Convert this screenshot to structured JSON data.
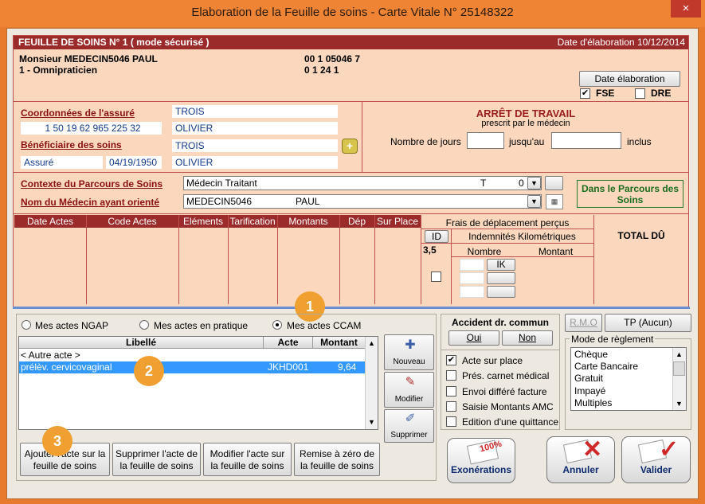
{
  "window": {
    "title": "Elaboration de la Feuille de soins - Carte Vitale N° 25148322",
    "close": "×"
  },
  "header": {
    "title": "FEUILLE DE SOINS  N° 1 ( mode sécurisé )",
    "date": "Date d'élaboration 10/12/2014",
    "doctor_name": "Monsieur MEDECIN5046 PAUL",
    "doctor_specialty": "1 - Omnipraticien",
    "code1": "00 1 05046 7",
    "code2": "0 1 24 1",
    "date_button": "Date élaboration",
    "fse_label": "FSE",
    "dre_label": "DRE"
  },
  "insured": {
    "label": "Coordonnées de l'assuré",
    "number": "1 50 19 62 965 225 32",
    "lastname": "TROIS",
    "firstname": "OLIVIER",
    "beneficiary_label": "Bénéficiaire des soins",
    "beneficiary_lastname": "TROIS",
    "beneficiary_firstname": "OLIVIER",
    "beneficiary_type": "Assuré",
    "birthdate": "04/19/1950"
  },
  "arret": {
    "title": "ARRÊT DE TRAVAIL",
    "subtitle": "prescrit par le médecin",
    "days_label": "Nombre de jours",
    "until_label": "jusqu'au",
    "inclusive_label": "inclus",
    "days_value": "",
    "until_value": ""
  },
  "parcours": {
    "context_label": "Contexte du Parcours de Soins",
    "context_value": "Médecin Traitant",
    "context_code": "T",
    "context_num": "0",
    "doctor_label": "Nom du Médecin ayant orienté",
    "doctor_lastname": "MEDECIN5046",
    "doctor_firstname": "PAUL",
    "badge": "Dans le Parcours des Soins"
  },
  "acts_grid": {
    "columns": [
      "Date Actes",
      "Code Actes",
      "Eléments",
      "Tarification",
      "Montants",
      "Dép",
      "Sur Place"
    ],
    "frais_title": "Frais de déplacement perçus",
    "id_label": "ID",
    "ik_title": "Indemnités Kilométriques",
    "id_value": "3,5",
    "nombre_label": "Nombre",
    "montant_label": "Montant",
    "ik_btn": "IK",
    "total_label": "TOTAL DÛ"
  },
  "acts_filter": {
    "ngap": "Mes actes NGAP",
    "pratique": "Mes actes en pratique",
    "ccam": "Mes actes CCAM",
    "selected": "ccam"
  },
  "acts_list": {
    "columns": [
      "Libellé",
      "Acte",
      "Montant"
    ],
    "rows": [
      {
        "label": "< Autre acte >",
        "code": "",
        "amount": ""
      },
      {
        "label": "prélèv. cervicovaginal",
        "code": "JKHD001",
        "amount": "9,64"
      }
    ]
  },
  "list_side_buttons": {
    "nouveau": "Nouveau",
    "modifier": "Modifier",
    "supprimer": "Supprimer"
  },
  "bottom_buttons": {
    "add_line1": "Ajouter l'acte sur la",
    "add_line2": "feuille de soins",
    "del_line1": "Supprimer l'acte de",
    "del_line2": "la feuille de soins",
    "mod_line1": "Modifier l'acte sur",
    "mod_line2": "la feuille de soins",
    "reset_line1": "Remise à zéro de",
    "reset_line2": "la feuille de soins"
  },
  "accident": {
    "title": "Accident dr. commun",
    "oui": "Oui",
    "non": "Non"
  },
  "options": [
    {
      "label": "Acte sur place",
      "checked": true
    },
    {
      "label": "Prés. carnet médical",
      "checked": false
    },
    {
      "label": "Envoi différé facture",
      "checked": false
    },
    {
      "label": "Saisie Montants AMC",
      "checked": false
    },
    {
      "label": "Edition d'une quittance",
      "checked": false
    }
  ],
  "payment": {
    "rmo": "R.M.O",
    "tp": "TP (Aucun)",
    "title": "Mode de règlement",
    "items": [
      "Chèque",
      "Carte Bancaire",
      "Gratuit",
      "Impayé",
      "Multiples"
    ]
  },
  "actions": {
    "exonerations": "Exonérations",
    "annuler": "Annuler",
    "valider": "Valider",
    "stamp": "100%"
  },
  "callouts": [
    "1",
    "2",
    "3"
  ]
}
